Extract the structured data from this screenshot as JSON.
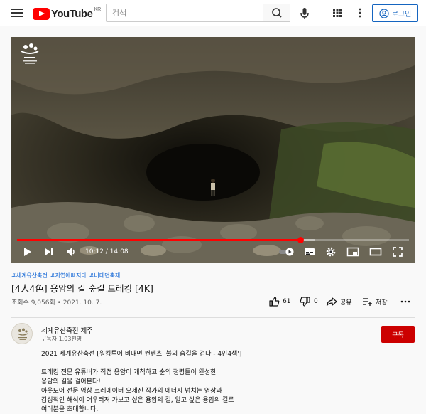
{
  "header": {
    "logo_text": "YouTube",
    "logo_country": "KR",
    "search_placeholder": "검색",
    "login_label": "로그인"
  },
  "player": {
    "current_time": "10:12",
    "duration": "14:08",
    "time_separator": " / ",
    "progress_fraction": 0.722,
    "buffer_fraction": 0.76
  },
  "video": {
    "hashtags": [
      "#세계유산축전",
      "#자연에빠지다",
      "#비대면축제"
    ],
    "title": "[4人4色] 용암의 길 숲길 트레킹 [4K]",
    "views": "조회수 9,056회",
    "date": "2021. 10. 7.",
    "likes": "61",
    "dislikes": "0",
    "share_label": "공유",
    "save_label": "저장"
  },
  "channel": {
    "name": "세계유산축전 제주",
    "subscribers": "구독자 1.03천명",
    "subscribe_label": "구독"
  },
  "description": {
    "lines": [
      "2021 세계유산축전 [워킹투어 비대면 컨텐츠 '불의 숨길을 걷다 - 4인4색']",
      "",
      "트레킹 전문 유튜버가 직접 용암이 개척하고 숲의 정령들이 완성한",
      "용암의 길을 걸어본다!",
      "아웃도어 전문 영상 크레에이터 오세진 작가의 에너지 넘치는 영상과",
      "감성적인 해석이 어우러져 가보고 싶은 용암의 길, 알고 싶은 용암의 길로",
      "여러분을 초대합니다."
    ]
  },
  "colors": {
    "brand_red": "#ff0000",
    "subscribe_red": "#cc0000",
    "link_blue": "#065fd4",
    "login_blue": "#1565c0"
  },
  "icons": [
    "menu-icon",
    "youtube-logo-icon",
    "search-icon",
    "mic-icon",
    "apps-icon",
    "more-vert-icon",
    "account-icon",
    "play-icon",
    "next-icon",
    "volume-icon",
    "autoplay-toggle-icon",
    "subtitles-icon",
    "settings-icon",
    "miniplayer-icon",
    "theater-icon",
    "fullscreen-icon",
    "like-icon",
    "dislike-icon",
    "share-icon",
    "save-icon",
    "more-horiz-icon"
  ]
}
